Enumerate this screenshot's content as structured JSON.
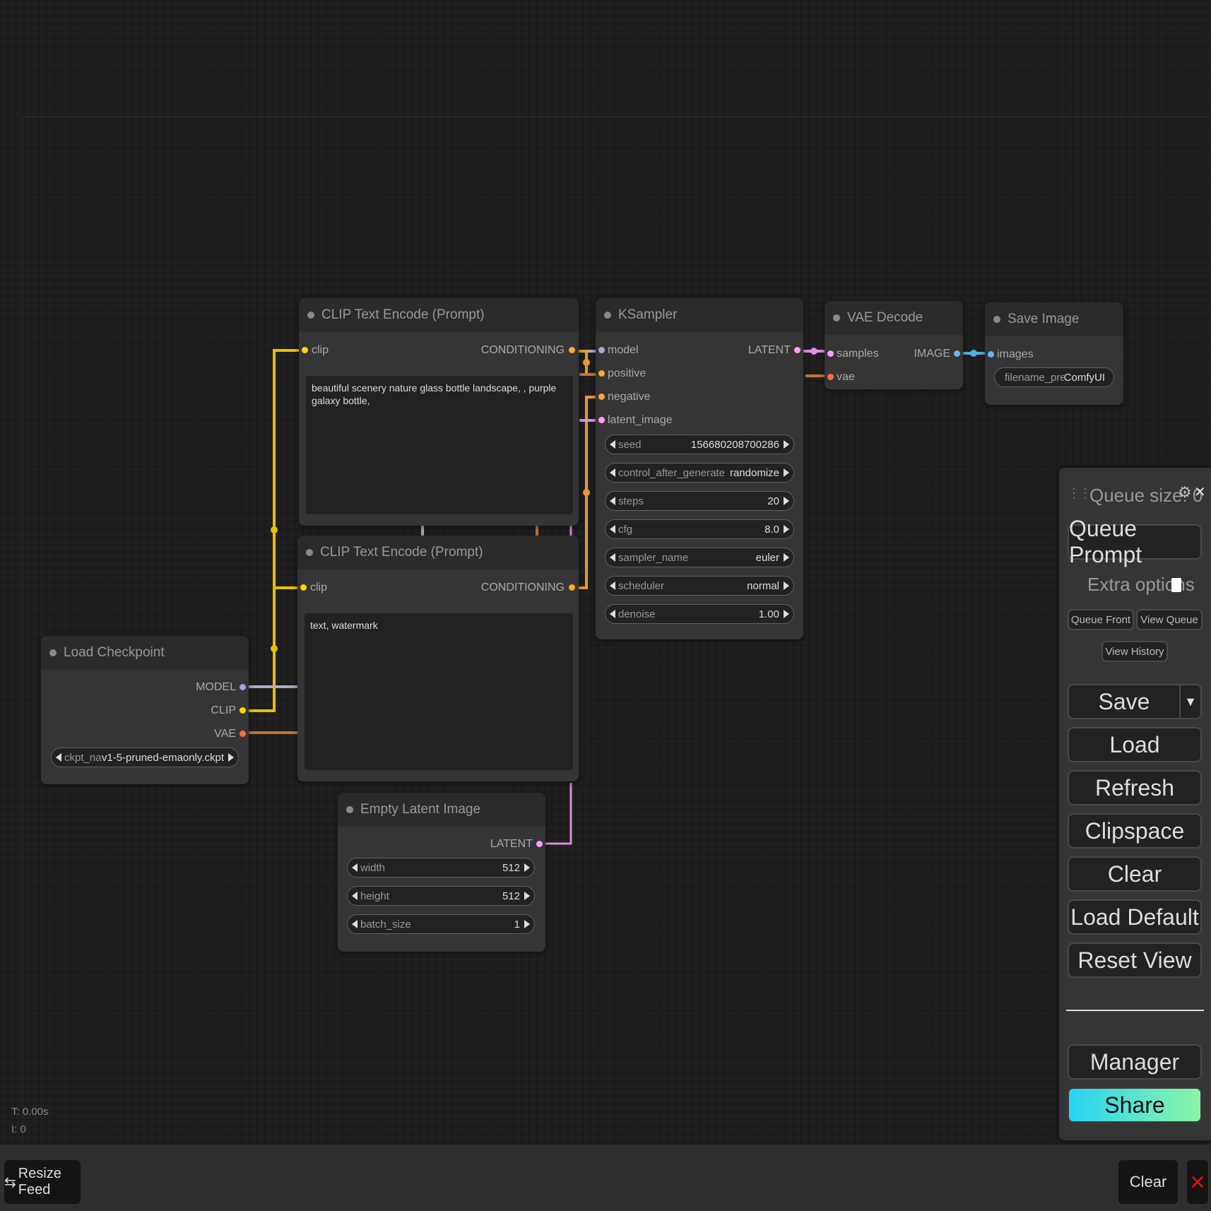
{
  "nodes": {
    "clip_pos": {
      "title": "CLIP Text Encode (Prompt)",
      "input": "clip",
      "output": "CONDITIONING",
      "text": "beautiful scenery nature glass bottle landscape, , purple galaxy bottle,"
    },
    "clip_neg": {
      "title": "CLIP Text Encode (Prompt)",
      "input": "clip",
      "output": "CONDITIONING",
      "text": "text, watermark"
    },
    "ksampler": {
      "title": "KSampler",
      "inputs": [
        "model",
        "positive",
        "negative",
        "latent_image"
      ],
      "output": "LATENT",
      "widgets": [
        {
          "label": "seed",
          "value": "156680208700286"
        },
        {
          "label": "control_after_generate",
          "value": "randomize"
        },
        {
          "label": "steps",
          "value": "20"
        },
        {
          "label": "cfg",
          "value": "8.0"
        },
        {
          "label": "sampler_name",
          "value": "euler"
        },
        {
          "label": "scheduler",
          "value": "normal"
        },
        {
          "label": "denoise",
          "value": "1.00"
        }
      ]
    },
    "vae_decode": {
      "title": "VAE Decode",
      "inputs": [
        "samples",
        "vae"
      ],
      "output": "IMAGE"
    },
    "save_image": {
      "title": "Save Image",
      "input": "images",
      "widget": {
        "label": "filename_prefix",
        "value": "ComfyUI"
      }
    },
    "load_checkpoint": {
      "title": "Load Checkpoint",
      "outputs": [
        "MODEL",
        "CLIP",
        "VAE"
      ],
      "widget": {
        "label": "ckpt_name",
        "value": "v1-5-pruned-emaonly.ckpt"
      }
    },
    "empty_latent": {
      "title": "Empty Latent Image",
      "output": "LATENT",
      "widgets": [
        {
          "label": "width",
          "value": "512"
        },
        {
          "label": "height",
          "value": "512"
        },
        {
          "label": "batch_size",
          "value": "1"
        }
      ]
    }
  },
  "menu": {
    "queue_size": "Queue size: 0",
    "queue_prompt": "Queue Prompt",
    "extra_options": "Extra options",
    "queue_front": "Queue Front",
    "view_queue": "View Queue",
    "view_history": "View History",
    "save": "Save",
    "save_arrow": "▼",
    "load": "Load",
    "refresh": "Refresh",
    "clipspace": "Clipspace",
    "clear": "Clear",
    "load_default": "Load Default",
    "reset_view": "Reset View",
    "manager": "Manager",
    "share": "Share",
    "close": "✕",
    "gear": "⚙"
  },
  "stats": {
    "t": "T: 0.00s",
    "i": "I: 0"
  },
  "footer": {
    "resize_feed": "Resize Feed",
    "resize_icon": "⇆",
    "clear": "Clear",
    "close": "✕"
  },
  "colors": {
    "clip": "#ffd500",
    "conditioning": "#ffa931",
    "model": "#b39ddb",
    "vae": "#ff6e40",
    "latent": "#ff9cf9",
    "image": "#64b5f6",
    "share_start": "#27d3f5",
    "share_end": "#8df5a6"
  }
}
